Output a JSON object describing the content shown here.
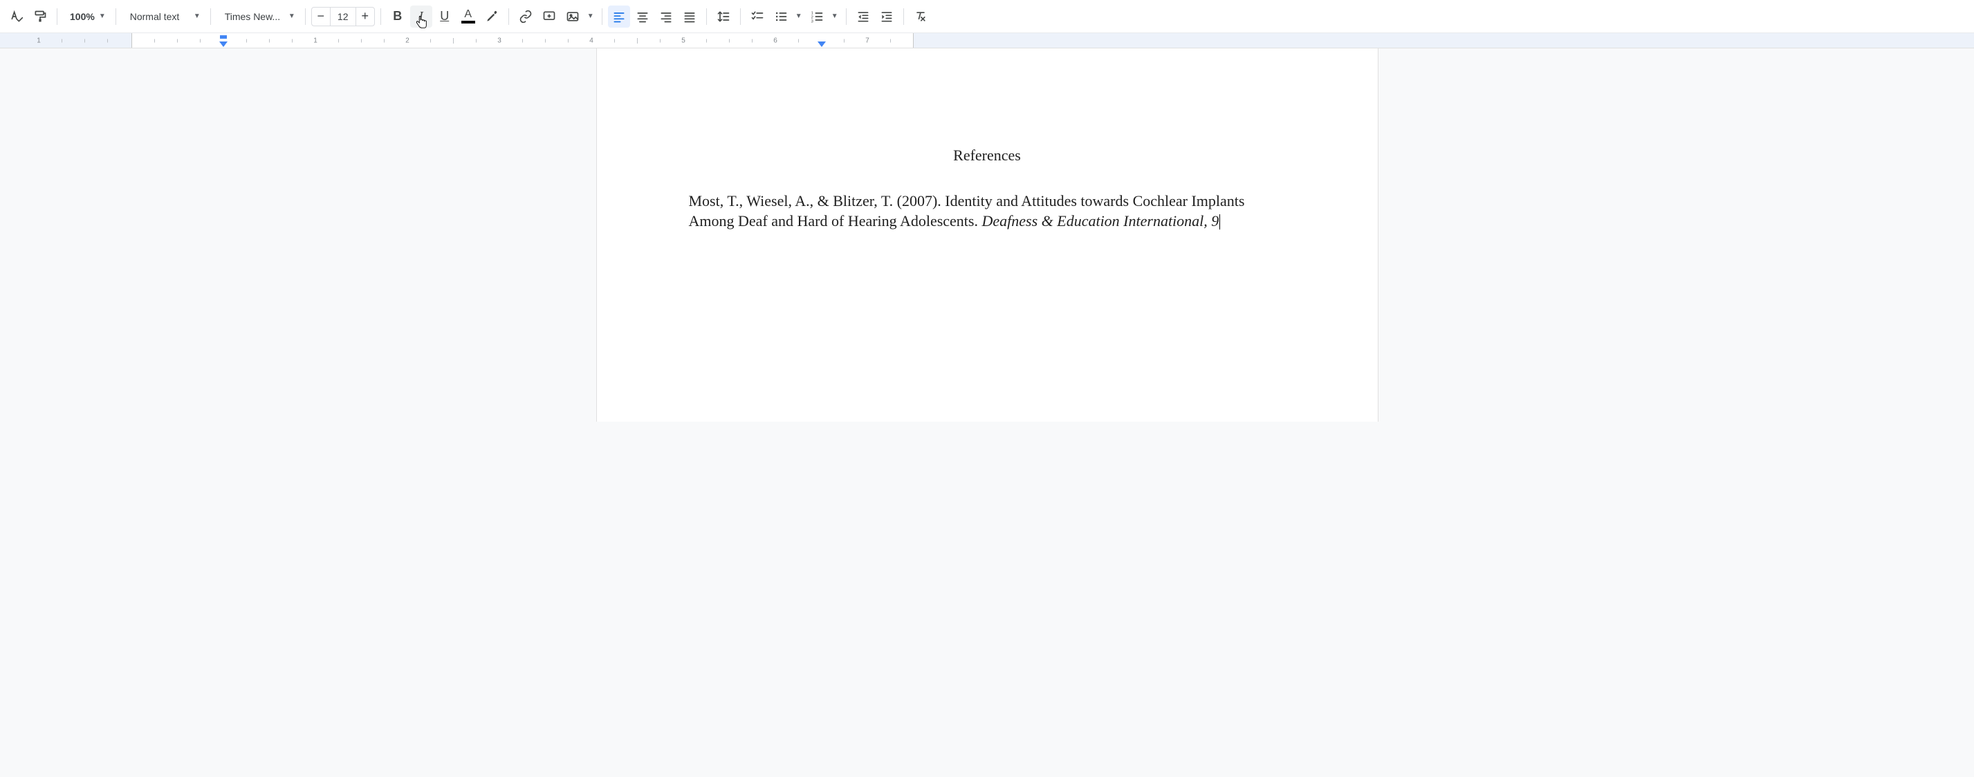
{
  "toolbar": {
    "zoom": "100%",
    "paragraph_style": "Normal text",
    "font_family": "Times New...",
    "font_size": "12",
    "bold_label": "B",
    "italic_label": "I",
    "underline_label": "U",
    "text_color_label": "A"
  },
  "ruler": {
    "labels": [
      "1",
      "1",
      "2",
      "3",
      "4",
      "5",
      "6",
      "7"
    ]
  },
  "document": {
    "heading": "References",
    "reference_plain": "Most, T., Wiesel, A., & Blitzer, T. (2007). Identity and Attitudes towards Cochlear Implants Among Deaf and Hard of Hearing Adolescents. ",
    "reference_italic": "Deafness & Education International, 9"
  }
}
